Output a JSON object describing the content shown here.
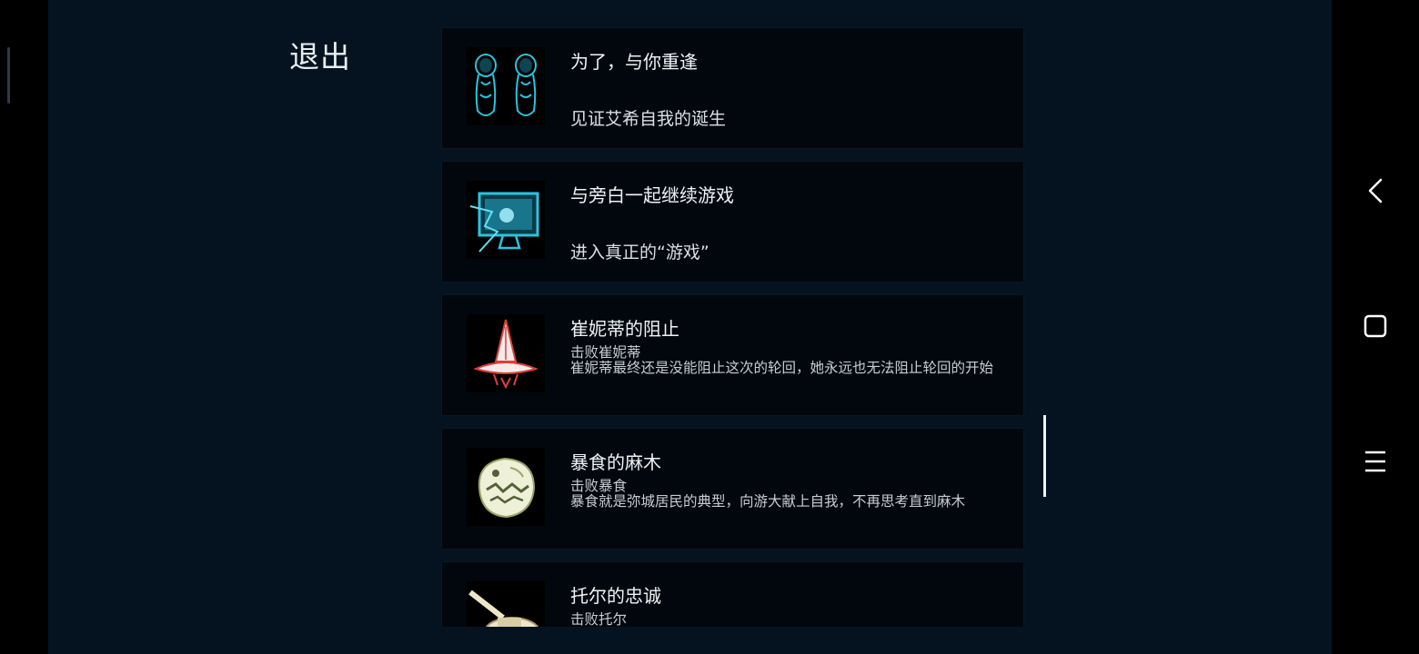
{
  "header": {
    "exit_label": "退出"
  },
  "achievements": [
    {
      "title": "为了，与你重逢",
      "subtitle": "见证艾希自我的诞生",
      "icon": "twin-figures-icon"
    },
    {
      "title": "与旁白一起继续游戏",
      "subtitle": "进入真正的“游戏”",
      "icon": "computer-monitor-icon"
    },
    {
      "title": "崔妮蒂的阻止",
      "subtitle": "击败崔妮蒂",
      "description": "崔妮蒂最终还是没能阻止这次的轮回，她永远也无法阻止轮回的开始",
      "icon": "spaceship-icon"
    },
    {
      "title": "暴食的麻木",
      "subtitle": "击败暴食",
      "description": "暴食就是弥城居民的典型，向游大献上自我，不再思考直到麻木",
      "icon": "gluttony-beast-icon"
    },
    {
      "title": "托尔的忠诚",
      "subtitle": "击败托尔",
      "icon": "tank-icon"
    }
  ],
  "system_nav": {
    "back": "back-icon",
    "home": "home-icon",
    "recents": "recents-icon"
  },
  "colors": {
    "background": "#04131f",
    "card": "#01070d",
    "text": "#f0f3f5",
    "accent_cyan": "#29c4e0",
    "accent_red": "#d9403c"
  }
}
